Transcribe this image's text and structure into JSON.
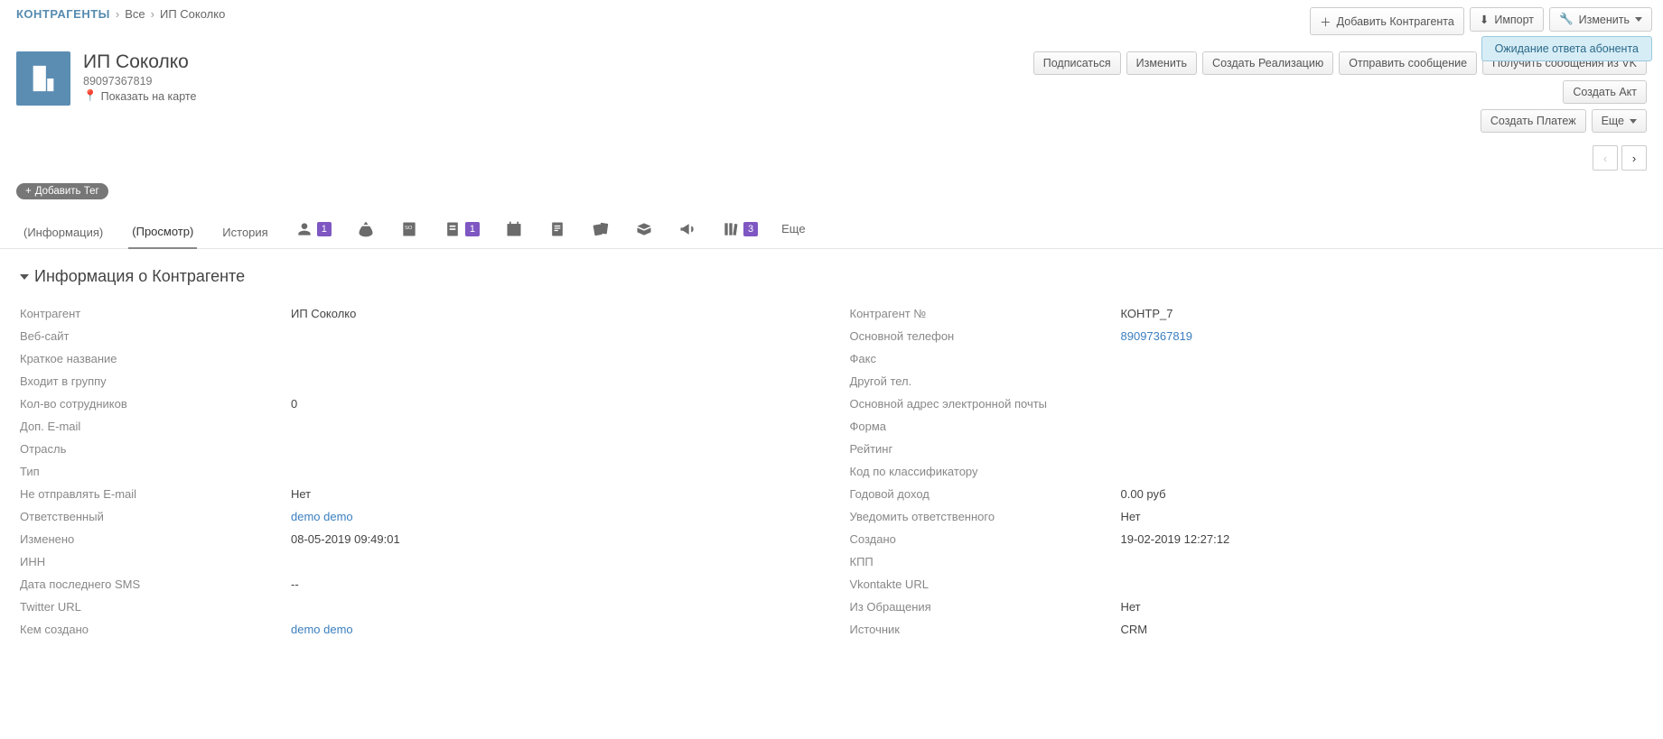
{
  "breadcrumb": {
    "root": "КОНТРАГЕНТЫ",
    "all": "Все",
    "current": "ИП Соколко"
  },
  "topactions": {
    "add": "Добавить Контрагента",
    "import": "Импорт",
    "edit": "Изменить"
  },
  "notification": "Ожидание ответа абонента",
  "header": {
    "title": "ИП Соколко",
    "phone": "89097367819",
    "map": "Показать на карте"
  },
  "actions": {
    "subscribe": "Подписаться",
    "edit": "Изменить",
    "create_sale": "Создать Реализацию",
    "send_msg": "Отправить сообщение",
    "get_vk": "Получить сообщения из VK",
    "create_act": "Создать Акт",
    "create_payment": "Создать Платеж",
    "more": "Еще"
  },
  "tag": "Добавить Тег",
  "tabs": {
    "info": "(Информация)",
    "view": "(Просмотр)",
    "history": "История",
    "more": "Еще",
    "badges": {
      "contacts": "1",
      "docs": "1",
      "forms": "3"
    }
  },
  "section_title": "Информация о Контрагенте",
  "fields_left": [
    {
      "label": "Контрагент",
      "value": "ИП Соколко",
      "link": false
    },
    {
      "label": "Веб-сайт",
      "value": "",
      "link": false
    },
    {
      "label": "Краткое название",
      "value": "",
      "link": false
    },
    {
      "label": "Входит в группу",
      "value": "",
      "link": false
    },
    {
      "label": "Кол-во сотрудников",
      "value": "0",
      "link": false
    },
    {
      "label": "Доп. E-mail",
      "value": "",
      "link": false
    },
    {
      "label": "Отрасль",
      "value": "",
      "link": false
    },
    {
      "label": "Тип",
      "value": "",
      "link": false
    },
    {
      "label": "Не отправлять E-mail",
      "value": "Нет",
      "link": false
    },
    {
      "label": "Ответственный",
      "value": "demo demo",
      "link": true
    },
    {
      "label": "Изменено",
      "value": "08-05-2019 09:49:01",
      "link": false
    },
    {
      "label": "ИНН",
      "value": "",
      "link": false
    },
    {
      "label": "Дата последнего SMS",
      "value": "--",
      "link": false
    },
    {
      "label": "Twitter URL",
      "value": "",
      "link": false
    },
    {
      "label": "Кем создано",
      "value": "demo demo",
      "link": true
    }
  ],
  "fields_right": [
    {
      "label": "Контрагент №",
      "value": "КОНТР_7",
      "link": false
    },
    {
      "label": "Основной телефон",
      "value": "89097367819",
      "link": true
    },
    {
      "label": "Факс",
      "value": "",
      "link": false
    },
    {
      "label": "Другой тел.",
      "value": "",
      "link": false
    },
    {
      "label": "Основной адрес электронной почты",
      "value": "",
      "link": false
    },
    {
      "label": "Форма",
      "value": "",
      "link": false
    },
    {
      "label": "Рейтинг",
      "value": "",
      "link": false
    },
    {
      "label": "Код по классификатору",
      "value": "",
      "link": false
    },
    {
      "label": "Годовой доход",
      "value": "0.00 руб",
      "link": false
    },
    {
      "label": "Уведомить ответственного",
      "value": "Нет",
      "link": false
    },
    {
      "label": "Создано",
      "value": "19-02-2019 12:27:12",
      "link": false
    },
    {
      "label": "КПП",
      "value": "",
      "link": false
    },
    {
      "label": "Vkontakte URL",
      "value": "",
      "link": false
    },
    {
      "label": "Из Обращения",
      "value": "Нет",
      "link": false
    },
    {
      "label": "Источник",
      "value": "CRM",
      "link": false
    }
  ]
}
